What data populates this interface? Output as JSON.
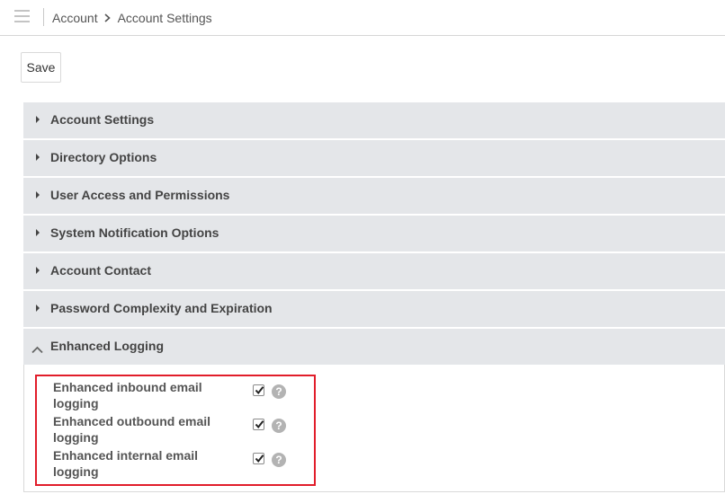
{
  "header": {
    "menu_icon": "hamburger-icon",
    "breadcrumb": [
      {
        "label": "Account"
      },
      {
        "label": "Account Settings"
      }
    ],
    "separator_icon": "chevron-right-icon"
  },
  "toolbar": {
    "save_label": "Save"
  },
  "sections": [
    {
      "label": "Account Settings",
      "expanded": false
    },
    {
      "label": "Directory Options",
      "expanded": false
    },
    {
      "label": "User Access and Permissions",
      "expanded": false
    },
    {
      "label": "System Notification Options",
      "expanded": false
    },
    {
      "label": "Account Contact",
      "expanded": false
    },
    {
      "label": "Password Complexity and Expiration",
      "expanded": false
    },
    {
      "label": "Enhanced Logging",
      "expanded": true
    }
  ],
  "enhanced_logging": {
    "options": [
      {
        "label": "Enhanced inbound email logging",
        "checked": true,
        "help": "?"
      },
      {
        "label": "Enhanced outbound email logging",
        "checked": true,
        "help": "?"
      },
      {
        "label": "Enhanced internal email logging",
        "checked": true,
        "help": "?"
      }
    ]
  },
  "colors": {
    "highlight": "#e11d2a",
    "section_header_bg": "#e4e6e9"
  }
}
